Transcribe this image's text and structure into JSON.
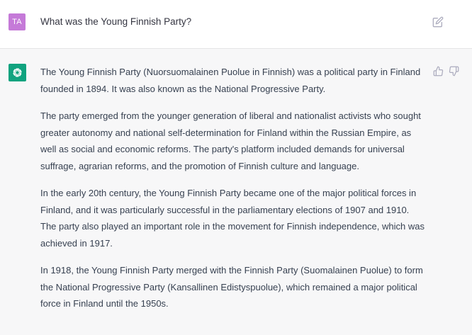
{
  "user": {
    "avatar_initials": "TA",
    "avatar_color": "#c57ad8",
    "message": "What was the Young Finnish Party?",
    "edit_icon": "edit-icon"
  },
  "assistant": {
    "avatar_icon": "openai-logo-icon",
    "avatar_color": "#10a37f",
    "paragraphs": [
      "The Young Finnish Party (Nuorsuomalainen Puolue in Finnish) was a political party in Finland founded in 1894. It was also known as the National Progressive Party.",
      "The party emerged from the younger generation of liberal and nationalist activists who sought greater autonomy and national self-determination for Finland within the Russian Empire, as well as social and economic reforms. The party's platform included demands for universal suffrage, agrarian reforms, and the promotion of Finnish culture and language.",
      "In the early 20th century, the Young Finnish Party became one of the major political forces in Finland, and it was particularly successful in the parliamentary elections of 1907 and 1910. The party also played an important role in the movement for Finnish independence, which was achieved in 1917.",
      "In 1918, the Young Finnish Party merged with the Finnish Party (Suomalainen Puolue) to form the National Progressive Party (Kansallinen Edistyspuolue), which remained a major political force in Finland until the 1950s."
    ],
    "feedback_icons": [
      "thumbs-up-icon",
      "thumbs-down-icon"
    ]
  }
}
